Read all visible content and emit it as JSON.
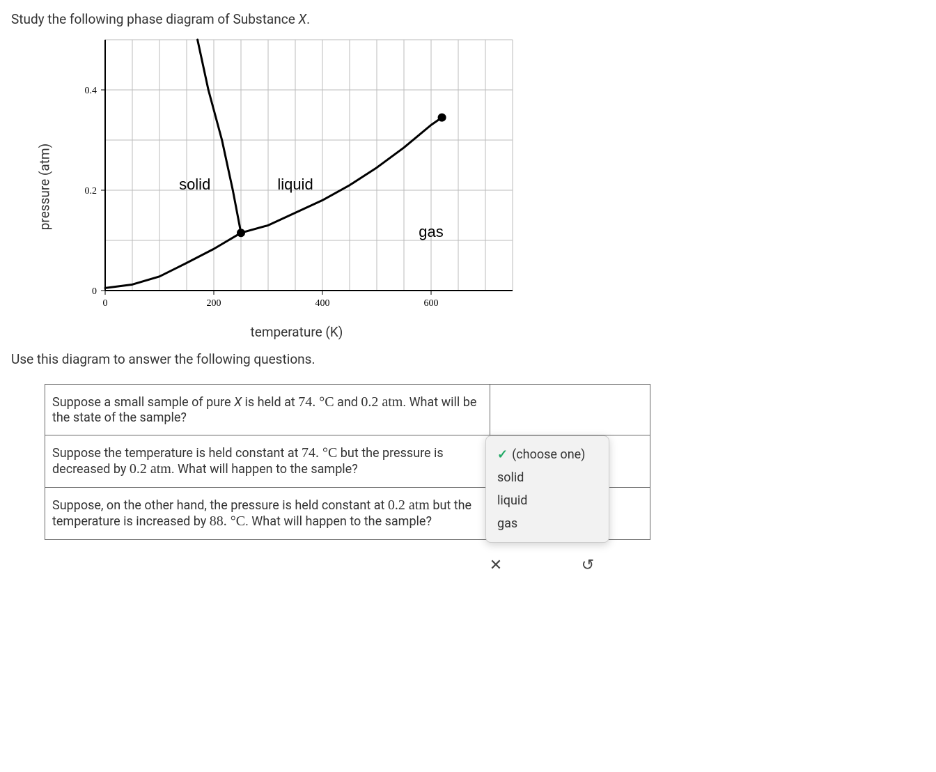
{
  "intro": {
    "line1_pre": "Study the following phase diagram of Substance ",
    "line1_em": "X",
    "line1_post": ".",
    "line2": "Use this diagram to answer the following questions."
  },
  "chart_data": {
    "type": "line",
    "title": "",
    "xlabel": "temperature (K)",
    "ylabel": "pressure (atm)",
    "xlim": [
      0,
      750
    ],
    "ylim": [
      0,
      0.5
    ],
    "xticks": [
      0,
      200,
      400,
      600
    ],
    "yticks": [
      0,
      0.2,
      0.4
    ],
    "x_gridlines": [
      0,
      50,
      100,
      150,
      200,
      250,
      300,
      350,
      400,
      450,
      500,
      550,
      600,
      650,
      700,
      750
    ],
    "y_gridlines": [
      0,
      0.1,
      0.2,
      0.3,
      0.4,
      0.5
    ],
    "triple_point": {
      "x": 250,
      "y": 0.115
    },
    "critical_point": {
      "x": 620,
      "y": 0.345
    },
    "series": [
      {
        "name": "sublimation (solid-gas)",
        "x": [
          0,
          50,
          100,
          150,
          200,
          250
        ],
        "values": [
          0.005,
          0.012,
          0.028,
          0.055,
          0.083,
          0.115
        ]
      },
      {
        "name": "fusion (solid-liquid)",
        "x": [
          250,
          235,
          215,
          190,
          170
        ],
        "values": [
          0.115,
          0.2,
          0.3,
          0.4,
          0.5
        ]
      },
      {
        "name": "vaporization (liquid-gas)",
        "x": [
          250,
          300,
          350,
          400,
          450,
          500,
          550,
          600,
          620
        ],
        "values": [
          0.115,
          0.13,
          0.155,
          0.18,
          0.21,
          0.245,
          0.285,
          0.33,
          0.345
        ]
      }
    ],
    "region_labels": [
      {
        "text": "solid",
        "x": 165,
        "y": 0.21
      },
      {
        "text": "liquid",
        "x": 350,
        "y": 0.21
      },
      {
        "text": "gas",
        "x": 600,
        "y": 0.115
      }
    ]
  },
  "questions": [
    {
      "parts": [
        {
          "t": "txt",
          "v": "Suppose a small sample of pure "
        },
        {
          "t": "em",
          "v": "X"
        },
        {
          "t": "txt",
          "v": " is held at "
        },
        {
          "t": "mj",
          "v": "74. °C"
        },
        {
          "t": "txt",
          "v": " and "
        },
        {
          "t": "mj",
          "v": "0.2 atm"
        },
        {
          "t": "txt",
          "v": ". What will be the state of the sample?"
        }
      ],
      "answer_kind": "dropdown_open"
    },
    {
      "parts": [
        {
          "t": "txt",
          "v": "Suppose the temperature is held constant at "
        },
        {
          "t": "mj",
          "v": "74. °C"
        },
        {
          "t": "txt",
          "v": " but the pressure is decreased by "
        },
        {
          "t": "mj",
          "v": "0.2 atm"
        },
        {
          "t": "txt",
          "v": ". What will happen to the sample?"
        }
      ],
      "answer_kind": "dropdown_closed"
    },
    {
      "parts": [
        {
          "t": "txt",
          "v": "Suppose, on the other hand, the pressure is held constant at "
        },
        {
          "t": "mj",
          "v": "0.2 atm"
        },
        {
          "t": "txt",
          "v": " but the temperature is increased by "
        },
        {
          "t": "mj",
          "v": "88. °C"
        },
        {
          "t": "txt",
          "v": ". What will happen to the sample?"
        }
      ],
      "answer_kind": "dropdown_closed"
    }
  ],
  "dropdown": {
    "placeholder": "(choose one)",
    "options": [
      "(choose one)",
      "solid",
      "liquid",
      "gas"
    ]
  },
  "actions": {
    "cancel_glyph": "✕",
    "reset_glyph": "↺"
  }
}
